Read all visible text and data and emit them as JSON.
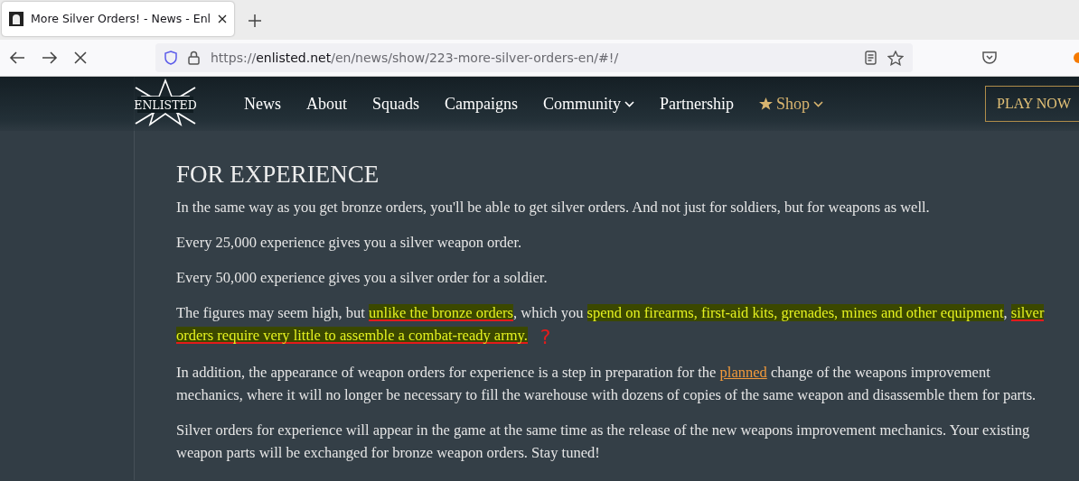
{
  "browser": {
    "tabs": [
      {
        "title": "More Silver Orders! - News - Enl",
        "selected": true
      }
    ],
    "url": {
      "scheme": "https://",
      "domain": "enlisted.net",
      "path": "/en/news/show/223-more-silver-orders-en/#!/"
    }
  },
  "nav": {
    "logo": "ENLISTED",
    "items": [
      {
        "label": "News",
        "kind": "plain"
      },
      {
        "label": "About",
        "kind": "plain"
      },
      {
        "label": "Squads",
        "kind": "plain"
      },
      {
        "label": "Campaigns",
        "kind": "plain"
      },
      {
        "label": "Community",
        "kind": "dropdown"
      },
      {
        "label": "Partnership",
        "kind": "plain"
      },
      {
        "label": "Shop",
        "kind": "shop"
      }
    ],
    "cta": "PLAY NOW"
  },
  "article": {
    "heading": "FOR EXPERIENCE",
    "paragraphs": [
      [
        {
          "text": "In the same way as you get bronze orders, you'll be able to get silver orders. And not just for soldiers, but for weapons as well.",
          "highlighted": false,
          "underlined": false
        }
      ],
      [
        {
          "text": "Every 25,000 experience gives you a silver weapon order.",
          "highlighted": false,
          "underlined": false
        }
      ],
      [
        {
          "text": "Every 50,000 experience gives you a silver order for a soldier.",
          "highlighted": false,
          "underlined": false
        }
      ],
      [
        {
          "text": "The figures may seem high, but ",
          "highlighted": false,
          "underlined": false
        },
        {
          "text": "unlike the bronze orders",
          "highlighted": true,
          "underlined": true
        },
        {
          "text": ", which you ",
          "highlighted": false,
          "underlined": false
        },
        {
          "text": "spend on firearms, first-aid kits, grenades, mines and other equipment",
          "highlighted": true,
          "underlined": false
        },
        {
          "text": ", ",
          "highlighted": false,
          "underlined": false
        },
        {
          "text": "silver orders require very little to assemble a combat-ready army.",
          "highlighted": true,
          "underlined": true
        },
        {
          "text": "?",
          "kind": "annotation"
        }
      ],
      [
        {
          "text": "In addition, the appearance of weapon orders for experience is a step in preparation for the ",
          "highlighted": false,
          "underlined": false
        },
        {
          "text": "planned",
          "kind": "link"
        },
        {
          "text": " change of the weapons improvement mechanics, where it will no longer be necessary to fill the warehouse with dozens of copies of the same weapon and disassemble them for parts.",
          "highlighted": false,
          "underlined": false
        }
      ],
      [
        {
          "text": "Silver orders for experience will appear in the game at the same time as the release of the new weapons improvement mechanics. Your existing weapon parts will be exchanged for bronze weapon orders. Stay tuned!",
          "highlighted": false,
          "underlined": false
        }
      ]
    ]
  }
}
